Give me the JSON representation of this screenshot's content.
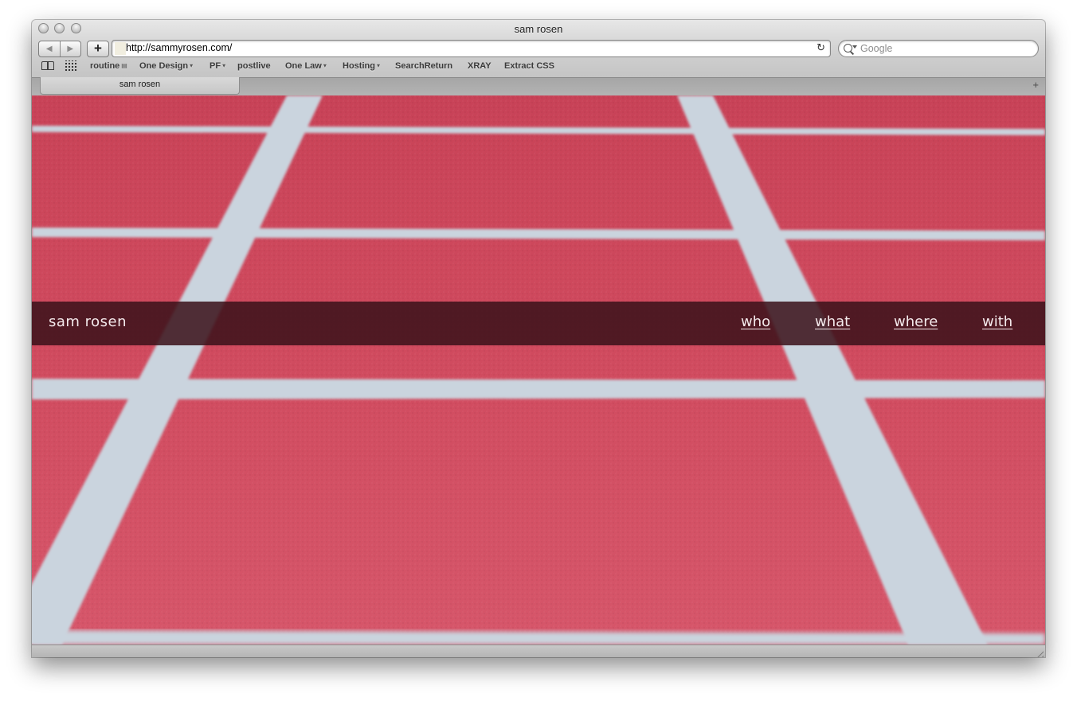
{
  "window": {
    "title": "sam rosen"
  },
  "toolbar": {
    "back_glyph": "◀",
    "forward_glyph": "▶",
    "add_glyph": "+",
    "url": "http://sammyrosen.com/",
    "reload_glyph": "↻",
    "search_placeholder": "Google"
  },
  "bookmarks": {
    "items": [
      {
        "label": "routine",
        "has_menu": true
      },
      {
        "label": "One Design",
        "has_menu": true
      },
      {
        "label": "PF",
        "has_menu": true
      },
      {
        "label": "postlive",
        "has_menu": false
      },
      {
        "label": "One Law",
        "has_menu": true
      },
      {
        "label": "Hosting",
        "has_menu": true
      },
      {
        "label": "SearchReturn",
        "has_menu": false
      },
      {
        "label": "XRAY",
        "has_menu": false
      },
      {
        "label": "Extract CSS",
        "has_menu": false
      }
    ],
    "menu_glyph": "▾"
  },
  "tabs": {
    "active_label": "sam rosen",
    "new_tab_glyph": "+"
  },
  "site": {
    "title": "sam rosen",
    "nav": [
      {
        "label": "who"
      },
      {
        "label": "what"
      },
      {
        "label": "where"
      },
      {
        "label": "with"
      }
    ],
    "colors": {
      "track_red": "#cf4a5c",
      "line_white": "#cbd5de",
      "bar_overlay": "#3a121a"
    }
  }
}
